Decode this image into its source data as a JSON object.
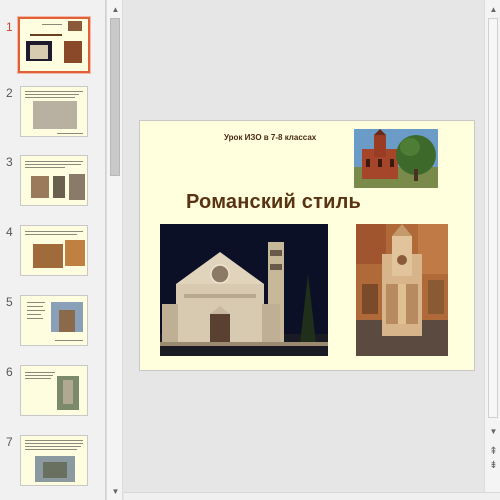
{
  "slides": [
    {
      "number": "1"
    },
    {
      "number": "2"
    },
    {
      "number": "3"
    },
    {
      "number": "4"
    },
    {
      "number": "5"
    },
    {
      "number": "6"
    },
    {
      "number": "7"
    }
  ],
  "current_slide": {
    "subtitle": "Урок ИЗО в 7-8 классах",
    "title": "Романский стиль"
  },
  "scroll": {
    "up_icon": "▲",
    "down_icon": "▼",
    "prev_slide_icon": "⇞",
    "next_slide_icon": "⇟"
  },
  "colors": {
    "slide_bg": "#ffffdd",
    "title": "#5a3312",
    "active_thumb_border": "#e0603a",
    "active_number": "#d24726"
  }
}
